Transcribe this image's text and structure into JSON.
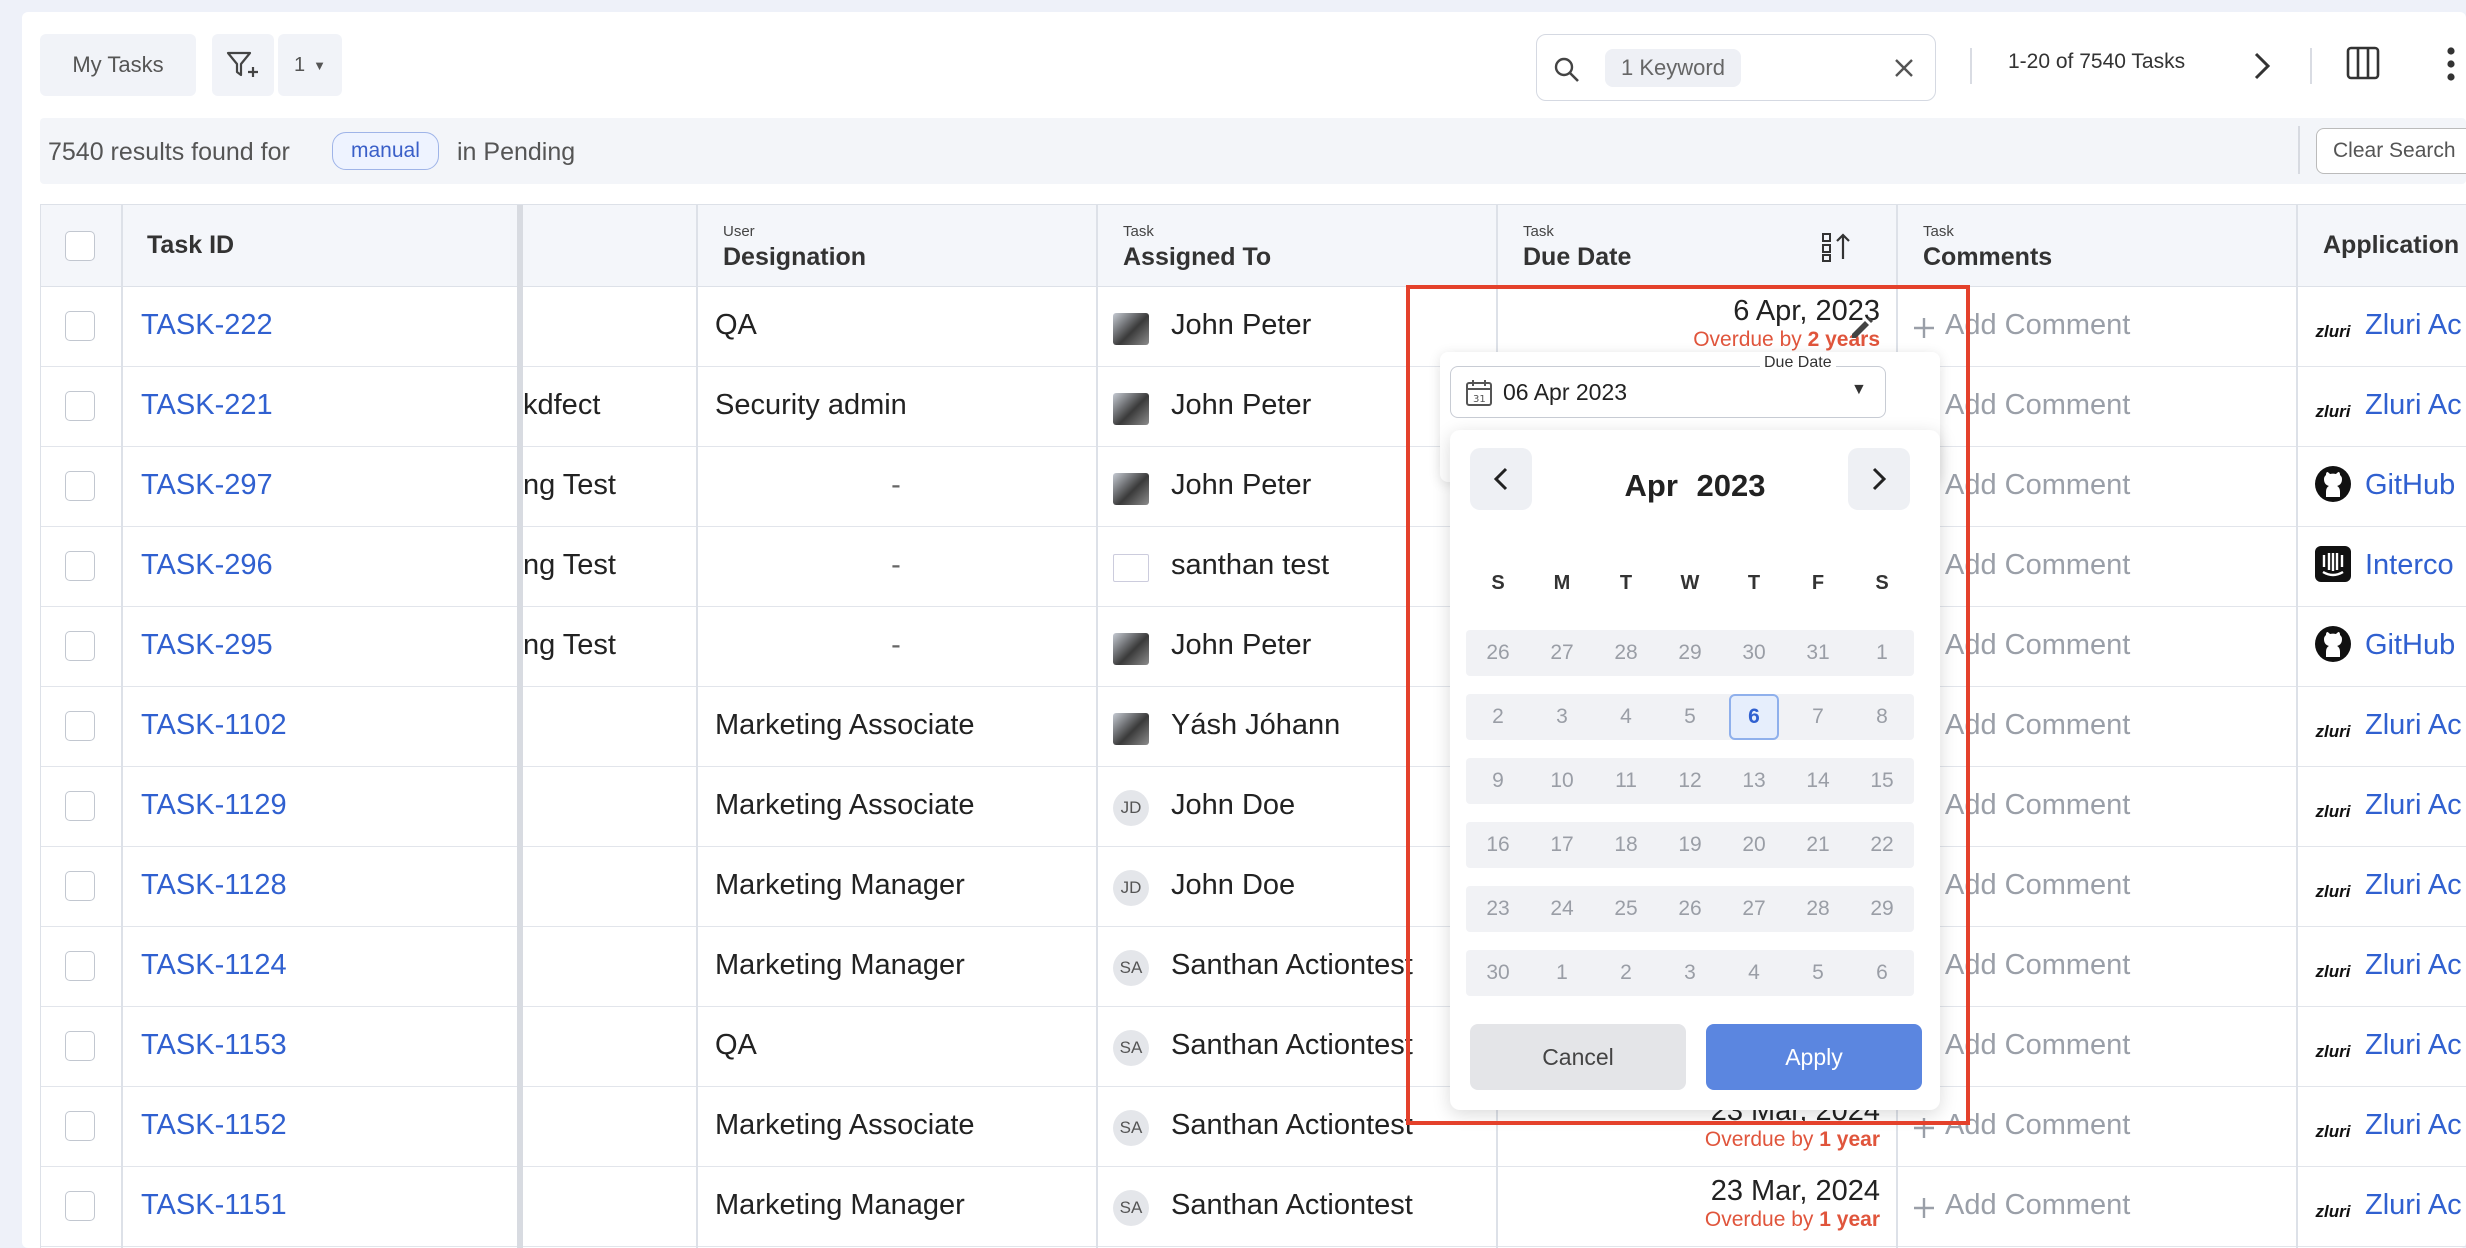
{
  "toolbar": {
    "my_tasks_label": "My Tasks",
    "filter_count": "1",
    "search_chip": "1 Keyword",
    "pager_text": "1-20 of 7540 Tasks"
  },
  "results": {
    "prefix": "7540 results found for",
    "tag": "manual",
    "suffix": "in Pending",
    "clear_label": "Clear Search"
  },
  "table": {
    "headers": {
      "task_id": "Task ID",
      "designation_group": "User",
      "designation": "Designation",
      "assigned_group": "Task",
      "assigned": "Assigned To",
      "due_group": "Task",
      "due": "Due Date",
      "comments_group": "Task",
      "comments": "Comments",
      "application": "Application"
    },
    "add_comment_label": "Add Comment",
    "rows": [
      {
        "id": "TASK-222",
        "col": "",
        "designation": "QA",
        "avatar": "",
        "assignee": "John Peter",
        "due": "6 Apr, 2023",
        "overdue_prefix": "Overdue by",
        "overdue_value": "2 years",
        "app_icon": "zluri",
        "app": "Zluri Ac"
      },
      {
        "id": "TASK-221",
        "col": "kdfect",
        "designation": "Security admin",
        "avatar": "",
        "assignee": "John Peter",
        "due": "",
        "overdue_prefix": "",
        "overdue_value": "",
        "app_icon": "zluri",
        "app": "Zluri Ac"
      },
      {
        "id": "TASK-297",
        "col": "ng Test",
        "designation": "-",
        "avatar": "",
        "assignee": "John Peter",
        "due": "",
        "overdue_prefix": "",
        "overdue_value": "",
        "app_icon": "github",
        "app": "GitHub"
      },
      {
        "id": "TASK-296",
        "col": "ng Test",
        "designation": "-",
        "avatar": "",
        "assignee": "santhan test",
        "due": "",
        "overdue_prefix": "",
        "overdue_value": "",
        "app_icon": "intercom",
        "app": "Interco"
      },
      {
        "id": "TASK-295",
        "col": "ng Test",
        "designation": "-",
        "avatar": "",
        "assignee": "John Peter",
        "due": "",
        "overdue_prefix": "",
        "overdue_value": "",
        "app_icon": "github",
        "app": "GitHub"
      },
      {
        "id": "TASK-1102",
        "col": "",
        "designation": "Marketing Associate",
        "avatar": "",
        "assignee": "Yásh Jóhann",
        "due": "",
        "overdue_prefix": "",
        "overdue_value": "",
        "app_icon": "zluri",
        "app": "Zluri Ac"
      },
      {
        "id": "TASK-1129",
        "col": "",
        "designation": "Marketing Associate",
        "avatar": "JD",
        "assignee": "John Doe",
        "due": "",
        "overdue_prefix": "",
        "overdue_value": "",
        "app_icon": "zluri",
        "app": "Zluri Ac"
      },
      {
        "id": "TASK-1128",
        "col": "",
        "designation": "Marketing Manager",
        "avatar": "JD",
        "assignee": "John Doe",
        "due": "",
        "overdue_prefix": "",
        "overdue_value": "",
        "app_icon": "zluri",
        "app": "Zluri Ac"
      },
      {
        "id": "TASK-1124",
        "col": "",
        "designation": "Marketing Manager",
        "avatar": "SA",
        "assignee": "Santhan Actiontest",
        "due": "",
        "overdue_prefix": "",
        "overdue_value": "",
        "app_icon": "zluri",
        "app": "Zluri Ac"
      },
      {
        "id": "TASK-1153",
        "col": "",
        "designation": "QA",
        "avatar": "SA",
        "assignee": "Santhan Actiontest",
        "due": "",
        "overdue_prefix": "",
        "overdue_value": "",
        "app_icon": "zluri",
        "app": "Zluri Ac"
      },
      {
        "id": "TASK-1152",
        "col": "",
        "designation": "Marketing Associate",
        "avatar": "SA",
        "assignee": "Santhan Actiontest",
        "due": "23 Mar, 2024",
        "overdue_prefix": "Overdue by",
        "overdue_value": "1 year",
        "app_icon": "zluri",
        "app": "Zluri Ac"
      },
      {
        "id": "TASK-1151",
        "col": "",
        "designation": "Marketing Manager",
        "avatar": "SA",
        "assignee": "Santhan Actiontest",
        "due": "23 Mar, 2024",
        "overdue_prefix": "Overdue by",
        "overdue_value": "1 year",
        "app_icon": "zluri",
        "app": "Zluri Ac"
      }
    ]
  },
  "date_picker": {
    "field_value": "06 Apr 2023",
    "field_legend": "Due Date",
    "month": "Apr",
    "year": "2023",
    "weekdays": [
      "S",
      "M",
      "T",
      "W",
      "T",
      "F",
      "S"
    ],
    "weeks": [
      [
        "26",
        "27",
        "28",
        "29",
        "30",
        "31",
        "1"
      ],
      [
        "2",
        "3",
        "4",
        "5",
        "6",
        "7",
        "8"
      ],
      [
        "9",
        "10",
        "11",
        "12",
        "13",
        "14",
        "15"
      ],
      [
        "16",
        "17",
        "18",
        "19",
        "20",
        "21",
        "22"
      ],
      [
        "23",
        "24",
        "25",
        "26",
        "27",
        "28",
        "29"
      ],
      [
        "30",
        "1",
        "2",
        "3",
        "4",
        "5",
        "6"
      ]
    ],
    "selected_day": "6",
    "cancel_label": "Cancel",
    "apply_label": "Apply"
  }
}
